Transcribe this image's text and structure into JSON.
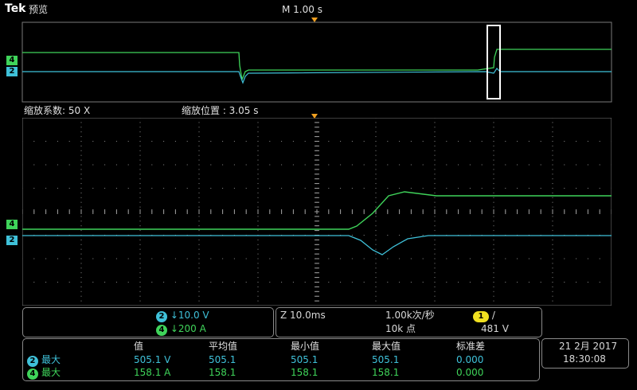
{
  "header": {
    "brand": "Tek",
    "mode": "预览",
    "timebase": "M 1.00 s"
  },
  "zoom": {
    "factor_label": "缩放系数: 50 X",
    "position_label": "缩放位置 : 3.05 s"
  },
  "channels": [
    {
      "id": "2",
      "color": "#3fc1d9",
      "scale": "↓10.0 V"
    },
    {
      "id": "4",
      "color": "#3fd45a",
      "scale": "↓200 A"
    }
  ],
  "acquisition": {
    "zoom_time": "Z 10.0ms",
    "rate": "1.00k次/秒",
    "record": "10k 点",
    "trigger_channel": "1",
    "trigger_color": "#f0e020",
    "trigger_slope": "/",
    "trigger_level": "481 V"
  },
  "measurements": {
    "headers": [
      "值",
      "平均值",
      "最小值",
      "最大值",
      "标准差"
    ],
    "rows": [
      {
        "ch": "2",
        "label": "最大",
        "color": "#3fc1d9",
        "values": [
          "505.1 V",
          "505.1",
          "505.1",
          "505.1",
          "0.000"
        ]
      },
      {
        "ch": "4",
        "label": "最大",
        "color": "#3fd45a",
        "values": [
          "158.1 A",
          "158.1",
          "158.1",
          "158.1",
          "0.000"
        ]
      }
    ]
  },
  "datetime": {
    "date": "21 2月 2017",
    "time": "18:30:08"
  },
  "colors": {
    "ch2": "#3fc1d9",
    "ch4": "#3fd45a",
    "trigger_marker": "#f0a020"
  }
}
